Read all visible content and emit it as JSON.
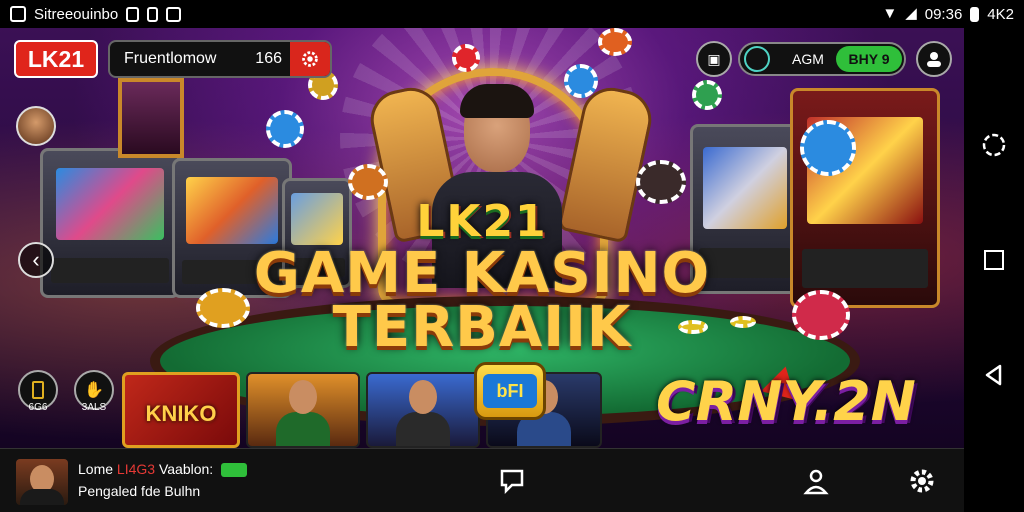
{
  "status_bar": {
    "app_name": "Sitreeouinbo",
    "time": "09:36",
    "carrier": "4K2"
  },
  "header": {
    "logo": "LK21",
    "search_text": "Fruentlomow",
    "search_number": "166",
    "wallet_amount": "AGM",
    "buy_label": "BHY 9"
  },
  "banner": {
    "brand": "LK21",
    "title_line1": "GAME KASINO",
    "title_line2": "TERBAIIK",
    "promo_logo": "CRNY.2N",
    "badge": "bFI"
  },
  "side_controls": [
    {
      "label": "6G6",
      "icon": "battery-icon"
    },
    {
      "label": "3ALS",
      "icon": "hand-icon"
    }
  ],
  "thumbnails": [
    {
      "title": "KNIKO"
    }
  ],
  "bottom_bar": {
    "line1_prefix": "Lome",
    "line1_highlight": "LI4G3",
    "line1_suffix": "Vaablon:",
    "line2": "Pengaled fde Bulhn"
  },
  "colors": {
    "brand_red": "#e0251b",
    "buy_green": "#2fbf3a",
    "gold": "#ffc94a",
    "background_purple": "#3b1055"
  }
}
